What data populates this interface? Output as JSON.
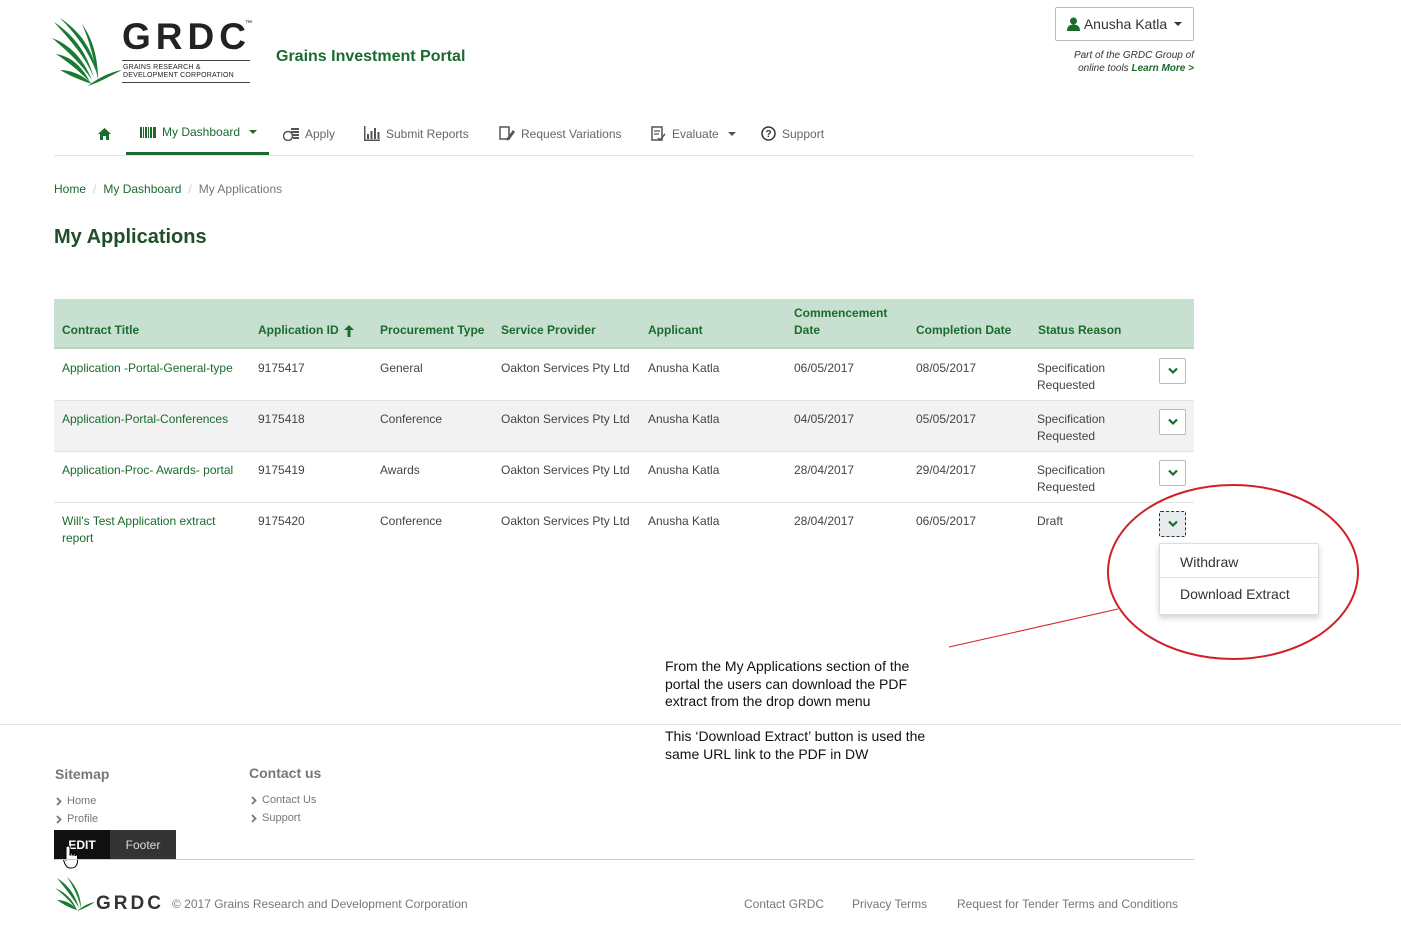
{
  "header": {
    "logo_text": "GRDC",
    "logo_tm": "™",
    "logo_subtitle_1": "GRAINS RESEARCH &",
    "logo_subtitle_2": "DEVELOPMENT CORPORATION",
    "portal_title": "Grains Investment Portal",
    "user_name": "Anusha Katla",
    "group_note_1": "Part of the GRDC Group of",
    "group_note_2": "online tools",
    "learn_more": "Learn More >"
  },
  "nav": {
    "items": [
      {
        "label": "My Dashboard"
      },
      {
        "label": "Apply"
      },
      {
        "label": "Submit Reports"
      },
      {
        "label": "Request Variations"
      },
      {
        "label": "Evaluate"
      },
      {
        "label": "Support"
      }
    ]
  },
  "breadcrumb": {
    "home": "Home",
    "dashboard": "My Dashboard",
    "current": "My Applications",
    "sep": "/"
  },
  "page_title": "My Applications",
  "table": {
    "headers": {
      "contract_title": "Contract Title",
      "application_id": "Application ID",
      "procurement_type": "Procurement Type",
      "service_provider": "Service Provider",
      "applicant": "Applicant",
      "commencement_1": "Commencement",
      "commencement_2": "Date",
      "completion": "Completion Date",
      "status": "Status Reason"
    },
    "rows": [
      {
        "title": "Application -Portal-General-type",
        "title2": "",
        "id": "9175417",
        "type": "General",
        "provider": "Oakton Services Pty Ltd",
        "applicant": "Anusha Katla",
        "start": "06/05/2017",
        "end": "08/05/2017",
        "status": "Specification",
        "status2": "Requested"
      },
      {
        "title": "Application-Portal-Conferences",
        "title2": "",
        "id": "9175418",
        "type": "Conference",
        "provider": "Oakton Services Pty Ltd",
        "applicant": "Anusha Katla",
        "start": "04/05/2017",
        "end": "05/05/2017",
        "status": "Specification",
        "status2": "Requested"
      },
      {
        "title": "Application-Proc- Awards- portal",
        "title2": "",
        "id": "9175419",
        "type": "Awards",
        "provider": "Oakton Services Pty Ltd",
        "applicant": "Anusha Katla",
        "start": "28/04/2017",
        "end": "29/04/2017",
        "status": "Specification",
        "status2": "Requested"
      },
      {
        "title": "Will's Test Application extract",
        "title2": "report",
        "id": "9175420",
        "type": "Conference",
        "provider": "Oakton Services Pty Ltd",
        "applicant": "Anusha Katla",
        "start": "28/04/2017",
        "end": "06/05/2017",
        "status": "Draft",
        "status2": ""
      }
    ]
  },
  "dropdown_menu": {
    "withdraw": "Withdraw",
    "download": "Download Extract"
  },
  "annotation": {
    "para1_line1": "From the My Applications section of the",
    "para1_line2": "portal the users can download the PDF",
    "para1_line3": "extract from the drop down menu",
    "para2_line1": "This ‘Download Extract’ button is used the",
    "para2_line2": "same URL link to the PDF in DW",
    "circle_color": "#d0202a"
  },
  "footer": {
    "sitemap_title": "Sitemap",
    "sitemap_links": [
      "Home",
      "Profile"
    ],
    "contact_title": "Contact us",
    "contact_links": [
      "Contact Us",
      "Support"
    ],
    "edit_label": "EDIT",
    "footer_label": "Footer",
    "small_logo": "GRDC",
    "copyright": "© 2017 Grains Research and Development Corporation",
    "links": [
      "Contact GRDC",
      "Privacy Terms",
      "Request for Tender Terms and Conditions"
    ]
  },
  "colors": {
    "brand_green": "#1a6b2d",
    "table_header_bg": "#c8e0d0"
  }
}
